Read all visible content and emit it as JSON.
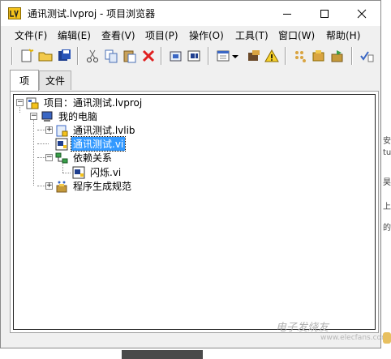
{
  "window": {
    "title": "通讯测试.lvproj - 项目浏览器"
  },
  "menu": [
    "文件(F)",
    "编辑(E)",
    "查看(V)",
    "项目(P)",
    "操作(O)",
    "工具(T)",
    "窗口(W)",
    "帮助(H)"
  ],
  "toolbar": {
    "icons": [
      "new-icon",
      "open-icon",
      "save-all-icon",
      "cut-icon",
      "copy-icon",
      "paste-icon",
      "delete-icon",
      "build-icon",
      "build-all-icon",
      "deploy-icon",
      "view-icon",
      "dropdown-icon",
      "properties-icon",
      "warning-icon",
      "add-folder-icon",
      "add-file-icon",
      "sync-icon",
      "checklist-icon"
    ]
  },
  "tabs": [
    "项",
    "文件"
  ],
  "tree": {
    "project": "项目：通讯测试.lvproj",
    "computer": "我的电脑",
    "library": "通讯测试.lvlib",
    "vi_selected": "通讯测试.vi",
    "dependencies": "依赖关系",
    "dep_vi": "闪烁.vi",
    "build_specs": "程序生成规范"
  },
  "side_text": [
    "安",
    "tu",
    "昊",
    "上",
    "的"
  ],
  "watermark": {
    "main": "电子发烧友",
    "sub": "www.elecfans.com"
  },
  "colors": {
    "selection": "#3399ff",
    "titlebar": "#ffffff",
    "chrome": "#f0f0f0"
  }
}
